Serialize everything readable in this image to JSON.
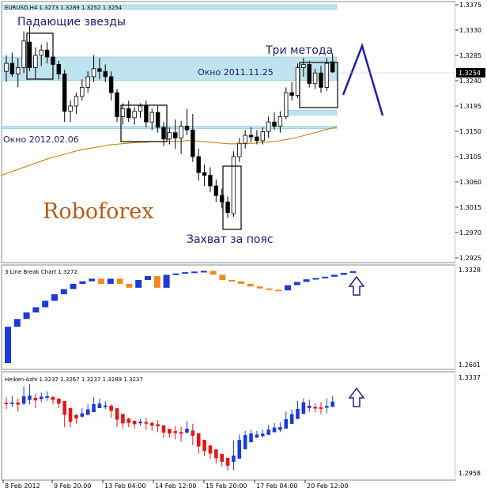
{
  "colors": {
    "panel_border": "#8a8a8a",
    "window_fill": "#bfe3ef",
    "window_edge": "#7fc4da",
    "ma_line": "#b8860b",
    "bull_body": "#ffffff",
    "bear_body": "#000000",
    "candle_wick": "#000000",
    "annot_box": "#000000",
    "label_text": "#1a1a6e",
    "forecast": "#1f1fa8",
    "brand": "#b35a1f",
    "lb_up": "#1e3ad6",
    "lb_down": "#f08a1e",
    "ha_up": "#1e3ad6",
    "ha_down": "#e01818",
    "arrow": "#1f1f8a",
    "grid_text": "#000000"
  },
  "main": {
    "title": "EURUSD,H4 1.3273 1.3289 1.3252 1.3254",
    "price_ticks": [
      "1.3375",
      "1.3330",
      "1.3285",
      "1.3240",
      "1.3195",
      "1.3150",
      "1.3105",
      "1.3060",
      "1.3015",
      "1.2970",
      "1.2925"
    ],
    "current_price": "1.3254",
    "labels": {
      "falling_stars": "Падающие звезды",
      "three_methods": "Три метода",
      "window_2011": "Окно 2011.11.25",
      "window_2012": "Окно 2012.02.06",
      "belt_hold": "Захват за пояс",
      "brand": "Roboforex"
    }
  },
  "line_break": {
    "title": "3 Line Break Chart 1.3272",
    "ticks": [
      "1.3328",
      "1.2601"
    ]
  },
  "heiken_ashi": {
    "title": "Heiken-Ashi 1.3237 1.3267 1.3237 1.3289 1.3237",
    "ticks": [
      "1.3337",
      "1.2958"
    ]
  },
  "time_axis": [
    "8 Feb 2012",
    "9 Feb 20:00",
    "13 Feb 04:00",
    "14 Feb 12:00",
    "15 Feb 20:00",
    "17 Feb 04:00",
    "20 Feb 12:00"
  ],
  "chart_data": {
    "type": "candlestick",
    "title": "EURUSD,H4 1.3273 1.3289 1.3252 1.3254",
    "ohlc": [
      [
        1.3255,
        1.3285,
        1.3235,
        1.327
      ],
      [
        1.327,
        1.329,
        1.3245,
        1.325
      ],
      [
        1.325,
        1.328,
        1.3225,
        1.3262
      ],
      [
        1.3262,
        1.333,
        1.3252,
        1.3312
      ],
      [
        1.331,
        1.334,
        1.3255,
        1.3262
      ],
      [
        1.3262,
        1.33,
        1.324,
        1.3285
      ],
      [
        1.3285,
        1.3305,
        1.3265,
        1.3295
      ],
      [
        1.3295,
        1.331,
        1.327,
        1.3282
      ],
      [
        1.3282,
        1.329,
        1.3255,
        1.3268
      ],
      [
        1.3268,
        1.3275,
        1.324,
        1.325
      ],
      [
        1.325,
        1.3258,
        1.316,
        1.318
      ],
      [
        1.318,
        1.32,
        1.316,
        1.319
      ],
      [
        1.319,
        1.3215,
        1.3175,
        1.3208
      ],
      [
        1.3208,
        1.324,
        1.32,
        1.3225
      ],
      [
        1.3225,
        1.3255,
        1.3215,
        1.3245
      ],
      [
        1.3245,
        1.3285,
        1.3235,
        1.326
      ],
      [
        1.326,
        1.328,
        1.324,
        1.3255
      ],
      [
        1.3255,
        1.3268,
        1.3235,
        1.3245
      ],
      [
        1.3245,
        1.3255,
        1.32,
        1.3215
      ],
      [
        1.3215,
        1.3222,
        1.316,
        1.317
      ],
      [
        1.317,
        1.3195,
        1.3155,
        1.3185
      ],
      [
        1.3185,
        1.32,
        1.316,
        1.3168
      ],
      [
        1.3168,
        1.3188,
        1.3155,
        1.318
      ],
      [
        1.318,
        1.3195,
        1.3168,
        1.319
      ],
      [
        1.319,
        1.32,
        1.315,
        1.316
      ],
      [
        1.316,
        1.3185,
        1.3145,
        1.3178
      ],
      [
        1.3178,
        1.319,
        1.314,
        1.315
      ],
      [
        1.315,
        1.316,
        1.3115,
        1.3128
      ],
      [
        1.3128,
        1.315,
        1.3118,
        1.314
      ],
      [
        1.314,
        1.3165,
        1.311,
        1.313
      ],
      [
        1.313,
        1.3162,
        1.31,
        1.3152
      ],
      [
        1.3152,
        1.3185,
        1.3135,
        1.3145
      ],
      [
        1.3145,
        1.3175,
        1.3085,
        1.3095
      ],
      [
        1.3095,
        1.311,
        1.305,
        1.3065
      ],
      [
        1.3065,
        1.308,
        1.304,
        1.306
      ],
      [
        1.306,
        1.3075,
        1.3028,
        1.304
      ],
      [
        1.304,
        1.3052,
        1.301,
        1.3022
      ],
      [
        1.3022,
        1.3035,
        1.2998,
        1.301
      ],
      [
        1.301,
        1.302,
        1.298,
        1.299
      ],
      [
        1.2988,
        1.3105,
        1.2982,
        1.3095
      ],
      [
        1.3095,
        1.313,
        1.3085,
        1.312
      ],
      [
        1.312,
        1.3145,
        1.311,
        1.3135
      ],
      [
        1.3135,
        1.315,
        1.3122,
        1.3132
      ],
      [
        1.3132,
        1.3145,
        1.3118,
        1.3125
      ],
      [
        1.3125,
        1.315,
        1.3118,
        1.3142
      ],
      [
        1.3142,
        1.317,
        1.313,
        1.316
      ],
      [
        1.316,
        1.3178,
        1.3145,
        1.3152
      ],
      [
        1.3152,
        1.318,
        1.314,
        1.317
      ],
      [
        1.317,
        1.3225,
        1.3165,
        1.3215
      ],
      [
        1.3215,
        1.3235,
        1.32,
        1.321
      ],
      [
        1.321,
        1.327,
        1.3205,
        1.3262
      ],
      [
        1.3262,
        1.328,
        1.3245,
        1.3268
      ],
      [
        1.3268,
        1.3275,
        1.3225,
        1.3232
      ],
      [
        1.3232,
        1.326,
        1.3222,
        1.3252
      ],
      [
        1.3252,
        1.3265,
        1.3215,
        1.3225
      ],
      [
        1.3225,
        1.328,
        1.3218,
        1.327
      ],
      [
        1.3273,
        1.3289,
        1.3252,
        1.3254
      ]
    ],
    "y_range": [
      1.2905,
      1.338
    ],
    "moving_average": [
      1.306,
      1.3064,
      1.3068,
      1.3072,
      1.3076,
      1.308,
      1.3084,
      1.3088,
      1.3092,
      1.3095,
      1.3098,
      1.3101,
      1.3104,
      1.3107,
      1.3109,
      1.3111,
      1.3113,
      1.3115,
      1.3117,
      1.3118,
      1.3119,
      1.312,
      1.3121,
      1.3122,
      1.3122,
      1.3123,
      1.3123,
      1.3123,
      1.3124,
      1.3124,
      1.3124,
      1.3125,
      1.3125,
      1.3124,
      1.3123,
      1.3122,
      1.3121,
      1.312,
      1.3119,
      1.3119,
      1.3119,
      1.312,
      1.312,
      1.3121,
      1.3122,
      1.3123,
      1.3124,
      1.3126,
      1.3128,
      1.313,
      1.3133,
      1.3136,
      1.3139,
      1.3142,
      1.3145,
      1.3148,
      1.3151
    ],
    "windows": [
      {
        "name": "Окно 2011.11.25",
        "low": 1.3238,
        "high": 1.3282
      },
      {
        "name": "Окно 2012.02.06",
        "low": 1.3148,
        "high": 1.3152
      }
    ],
    "gap_zone": {
      "low": 1.3175,
      "high": 1.3182
    },
    "line_break_blocks": [
      [
        1.262,
        1.29,
        "up"
      ],
      [
        1.29,
        1.296,
        "up"
      ],
      [
        1.296,
        1.301,
        "up"
      ],
      [
        1.301,
        1.305,
        "up"
      ],
      [
        1.305,
        1.31,
        "up"
      ],
      [
        1.31,
        1.315,
        "up"
      ],
      [
        1.315,
        1.319,
        "up"
      ],
      [
        1.319,
        1.323,
        "up"
      ],
      [
        1.323,
        1.325,
        "up"
      ],
      [
        1.325,
        1.327,
        "up"
      ],
      [
        1.327,
        1.323,
        "down"
      ],
      [
        1.323,
        1.327,
        "up"
      ],
      [
        1.327,
        1.323,
        "down"
      ],
      [
        1.323,
        1.32,
        "down"
      ],
      [
        1.32,
        1.326,
        "up"
      ],
      [
        1.326,
        1.329,
        "up"
      ],
      [
        1.329,
        1.32,
        "down"
      ],
      [
        1.32,
        1.33,
        "up"
      ],
      [
        1.33,
        1.331,
        "up"
      ],
      [
        1.331,
        1.332,
        "up"
      ],
      [
        1.332,
        1.3325,
        "up"
      ],
      [
        1.3325,
        1.333,
        "up"
      ],
      [
        1.333,
        1.33,
        "down"
      ],
      [
        1.33,
        1.326,
        "down"
      ],
      [
        1.326,
        1.325,
        "down"
      ],
      [
        1.325,
        1.323,
        "down"
      ],
      [
        1.323,
        1.321,
        "down"
      ],
      [
        1.321,
        1.3195,
        "down"
      ],
      [
        1.3195,
        1.3185,
        "down"
      ],
      [
        1.3185,
        1.318,
        "down"
      ],
      [
        1.318,
        1.322,
        "up"
      ],
      [
        1.322,
        1.3245,
        "up"
      ],
      [
        1.3245,
        1.3265,
        "up"
      ],
      [
        1.3265,
        1.3275,
        "up"
      ],
      [
        1.3275,
        1.3285,
        "up"
      ],
      [
        1.3285,
        1.33,
        "up"
      ],
      [
        1.33,
        1.3315,
        "up"
      ],
      [
        1.3315,
        1.3328,
        "up"
      ]
    ],
    "line_break_range": [
      1.259,
      1.3345
    ],
    "heiken_ashi_range": [
      1.295,
      1.3345
    ]
  }
}
